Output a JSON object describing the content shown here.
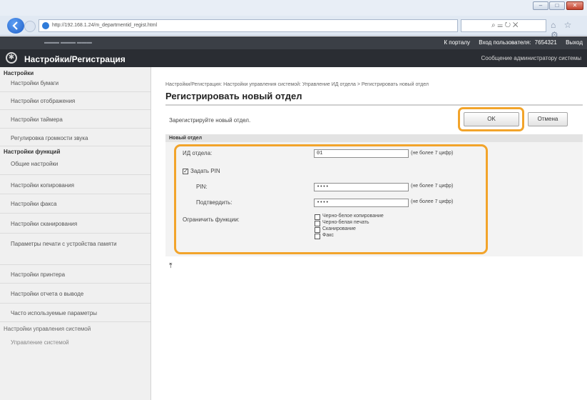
{
  "browser": {
    "url": "http://192.168.1.24/m_departmentid_regist.html",
    "search_glyph": "⌕ ☰ ↻ ✕",
    "toolbar_glyphs": "⌂ ☆ ⚙",
    "window_min": "–",
    "window_max": "□",
    "window_close": "✕"
  },
  "device_bar": {
    "portal_link": "К порталу",
    "login_label": "Вход пользователя:",
    "user_id": "7654321",
    "logout_link": "Выход"
  },
  "app": {
    "title": "Настройки/Регистрация",
    "message_link": "Сообщение администратору системы"
  },
  "sidebar": {
    "section1_title": "Настройки",
    "section1_items": [
      "Настройки бумаги",
      "Настройки отображения",
      "Настройки таймера",
      "Регулировка громкости звука"
    ],
    "section2_title": "Настройки функций",
    "section2_items": [
      "Общие настройки",
      "Настройки копирования",
      "Настройки факса",
      "Настройки сканирования",
      "Параметры печати с устройства памяти",
      "Настройки принтера",
      "Настройки отчета о выводе",
      "Часто используемые параметры"
    ],
    "section3_title": "Настройки управления системой",
    "section3_items": [
      "Управление системой"
    ]
  },
  "main": {
    "breadcrumb": "Настройки/Регистрация: Настройки управления системой: Управление ИД отдела > Регистрировать новый отдел",
    "page_title": "Регистрировать новый отдел",
    "instruction": "Зарегистрируйте новый отдел.",
    "ok_label": "OK",
    "cancel_label": "Отмена",
    "section_title": "Новый отдел"
  },
  "form": {
    "dept_id_label": "ИД отдела:",
    "dept_id_value": "01",
    "dept_id_hint": "(не более 7 цифр)",
    "set_pin_label": "Задать PIN",
    "set_pin_checked": true,
    "pin_label": "PIN:",
    "pin_value": "••••",
    "pin_hint": "(не более 7 цифр)",
    "confirm_label": "Подтвердить:",
    "confirm_value": "••••",
    "confirm_hint": "(не более 7 цифр)",
    "restrict_label": "Ограничить функции:",
    "restrict_options": [
      "Черно-белое копирование",
      "Черно-белая печать",
      "Сканирование",
      "Факс"
    ]
  },
  "colors": {
    "highlight": "#f2a42b",
    "header_dark": "#2a2d33"
  }
}
